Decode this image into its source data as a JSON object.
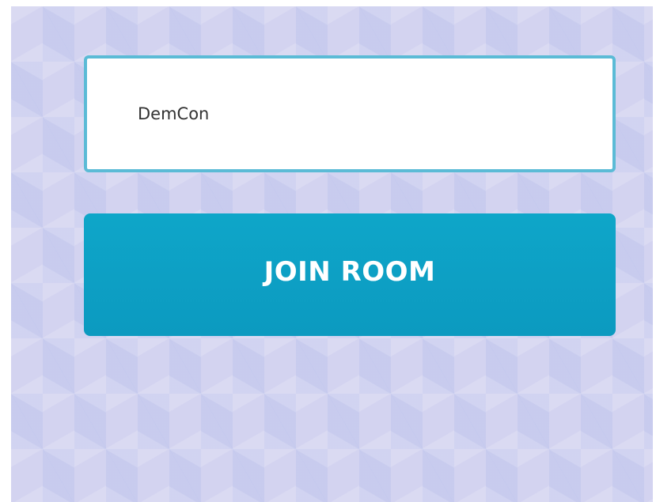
{
  "room_form": {
    "room_name_value": "DemCon",
    "join_button_label": "JOIN ROOM"
  },
  "colors": {
    "background": "#d3d3f0",
    "input_border": "#5bbbd6",
    "button_background": "#0e9fc4",
    "button_text": "#ffffff"
  }
}
